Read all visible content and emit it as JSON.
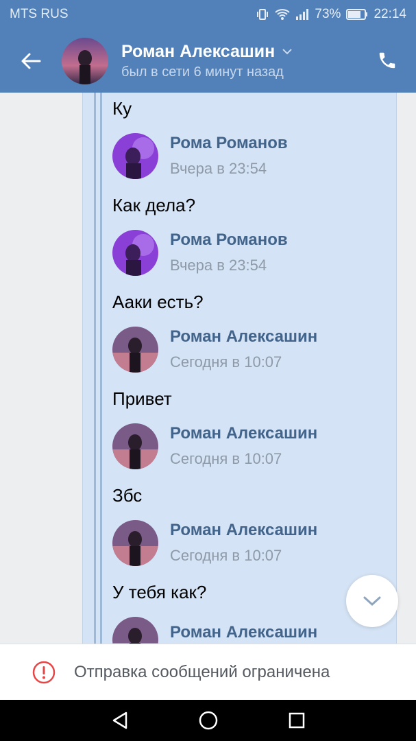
{
  "status": {
    "carrier": "MTS RUS",
    "battery": "73%",
    "time": "22:14"
  },
  "header": {
    "title": "Роман Алексашин",
    "subtitle": "был в сети 6 минут назад",
    "accent": "#5181b8"
  },
  "messages": [
    {
      "text": "Ку"
    },
    {
      "author": "Рома Романов",
      "time": "Вчера в 23:54",
      "avatar": "roma-avatar"
    },
    {
      "text": "Как дела?"
    },
    {
      "author": "Рома Романов",
      "time": "Вчера в 23:54",
      "avatar": "roma-avatar"
    },
    {
      "text": "Ааки есть?"
    },
    {
      "author": "Роман Алексашин",
      "time": "Сегодня в 10:07",
      "avatar": "roman-avatar"
    },
    {
      "text": "Привет"
    },
    {
      "author": "Роман Алексашин",
      "time": "Сегодня в 10:07",
      "avatar": "roman-avatar"
    },
    {
      "text": "Збс"
    },
    {
      "author": "Роман Алексашин",
      "time": "Сегодня в 10:07",
      "avatar": "roman-avatar"
    },
    {
      "text": "У тебя как?"
    },
    {
      "author": "Роман Алексашин",
      "avatar": "roman-avatar"
    }
  ],
  "notice": {
    "text": "Отправка сообщений ограничена",
    "color": "#e64646"
  }
}
